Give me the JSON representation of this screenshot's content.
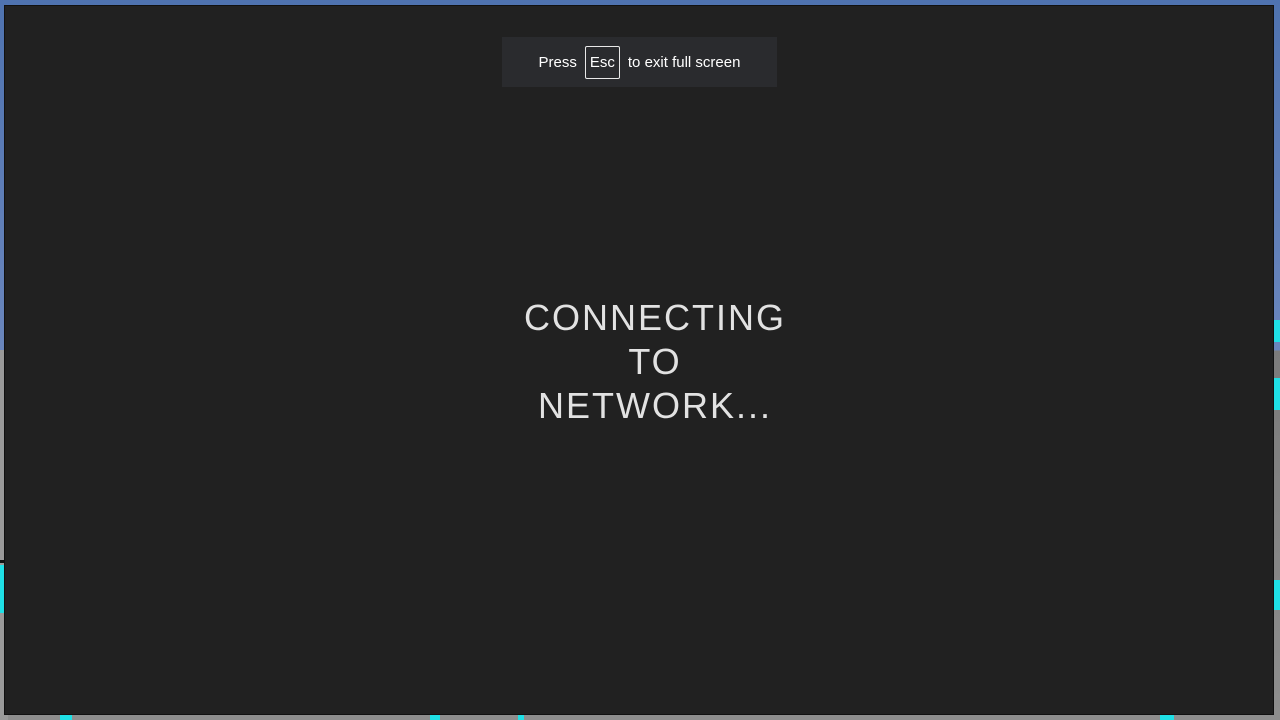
{
  "fullscreen_notice": {
    "prefix": "Press",
    "key": "Esc",
    "suffix": "to exit full screen"
  },
  "status": {
    "lines": [
      "CONNECTING",
      "TO",
      "NETWORK..."
    ]
  },
  "colors": {
    "overlay": "#212121",
    "toast": "#2a2b2e",
    "text": "#e2e2e2",
    "accent_cyan": "#1fe0e6"
  }
}
